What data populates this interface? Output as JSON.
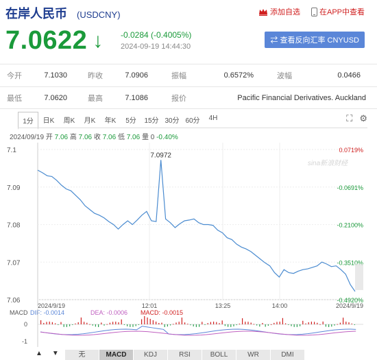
{
  "header": {
    "title": "在岸人民币",
    "code": "(USDCNY)",
    "add_watch": "添加自选",
    "app_view": "在APP中查看"
  },
  "quote": {
    "price": "7.0622",
    "arrow": "↓",
    "change": "-0.0284 (-0.4005%)",
    "time": "2024-09-19 14:44:30",
    "switch_label": "查看反向汇率 CNYUSD"
  },
  "stats": [
    [
      {
        "label": "今开",
        "value": "7.1030"
      },
      {
        "label": "昨收",
        "value": "7.0906"
      },
      {
        "label": "振幅",
        "value": "0.6572%"
      },
      {
        "label": "波幅",
        "value": "0.0466"
      }
    ],
    [
      {
        "label": "最低",
        "value": "7.0620"
      },
      {
        "label": "最高",
        "value": "7.1086"
      },
      {
        "label": "报价",
        "value": "Pacific Financial Derivatives. Auckland"
      }
    ]
  ],
  "tabs": [
    "1分",
    "日K",
    "周K",
    "月K",
    "年K",
    "5分",
    "15分",
    "30分",
    "60分",
    "4H"
  ],
  "active_tab": "1分",
  "summary": {
    "date": "2024/09/19",
    "open_label": "开",
    "open": "7.06",
    "high_label": "高",
    "high": "7.06",
    "close_label": "收",
    "close": "7.06",
    "low_label": "低",
    "low": "7.06",
    "vol_label": "量",
    "vol": "0",
    "pct": "-0.40%"
  },
  "watermark": "sina新浪财经",
  "bottom_tabs": [
    "无",
    "MACD",
    "KDJ",
    "RSI",
    "BOLL",
    "WR",
    "DMI"
  ],
  "active_bottom_tab": "MACD",
  "colors": {
    "down": "#1a9a3a",
    "up": "#d02020",
    "line": "#4a8bd0",
    "title": "#1d3c8f"
  },
  "chart_data": {
    "type": "line",
    "y_ticks": [
      "7.1",
      "7.09",
      "7.08",
      "7.07",
      "7.06"
    ],
    "y_values": [
      7.1,
      7.09,
      7.08,
      7.07,
      7.06
    ],
    "ylim": [
      7.06,
      7.1
    ],
    "right_ticks": [
      "0.0719%",
      "-0.0691%",
      "-0.2100%",
      "-0.3510%",
      "-0.4920%"
    ],
    "x_labels": [
      "2024/9/19",
      "12:01",
      "13:25",
      "14:00",
      "2024/9/19"
    ],
    "peak_label": "7.0972",
    "series": [
      {
        "values": [
          7.0945,
          7.0938,
          7.093,
          7.0928,
          7.0918,
          7.0905,
          7.0895,
          7.089,
          7.0878,
          7.0866,
          7.085,
          7.084,
          7.083,
          7.0825,
          7.0818,
          7.0808,
          7.08,
          7.0788,
          7.08,
          7.081,
          7.08,
          7.0812,
          7.0825,
          7.0835,
          7.081,
          7.0808,
          7.0972,
          7.0815,
          7.0805,
          7.0792,
          7.0802,
          7.081,
          7.0812,
          7.0815,
          7.0805,
          7.08,
          7.08,
          7.0798,
          7.0785,
          7.0778,
          7.0765,
          7.076,
          7.0748,
          7.074,
          7.0735,
          7.0728,
          7.0718,
          7.0708,
          7.0698,
          7.069,
          7.0672,
          7.066,
          7.068,
          7.0672,
          7.067,
          7.0676,
          7.068,
          7.0682,
          7.0686,
          7.069,
          7.07,
          7.0695,
          7.0688,
          7.069,
          7.068,
          7.0668,
          7.064,
          7.0622
        ]
      }
    ],
    "macd": {
      "dif_label": "DIF: -0.0014",
      "dea_label": "DEA: -0.0006",
      "macd_label": "MACD: -0.0015",
      "title": "MACD",
      "y_ticks": [
        "0",
        "-1"
      ]
    }
  }
}
